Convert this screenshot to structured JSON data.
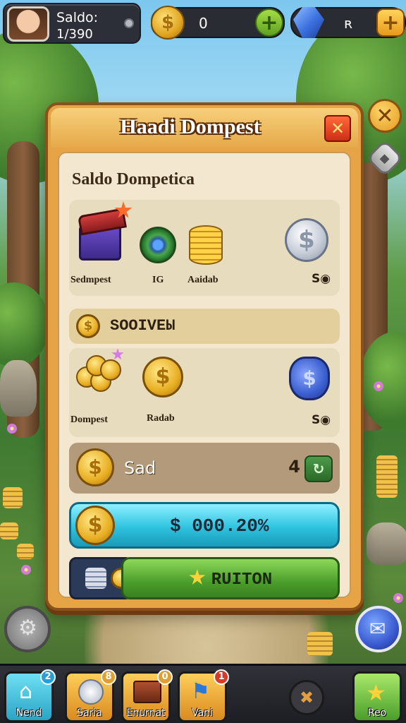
{
  "hud": {
    "profile_label": "Saldo:",
    "profile_value": "1/390",
    "coins_value": "0",
    "gems_value": "ʀ",
    "coin_glyph": "$",
    "plus_glyph": "+"
  },
  "panel": {
    "title": "Haadi Dompest",
    "close_glyph": "✕",
    "subtitle": "Saldo Dompetica",
    "row1": {
      "items": [
        {
          "label": "Sedmpest",
          "icon": "treasure-chest-icon"
        },
        {
          "label": "IG",
          "icon": "barrel-icon"
        },
        {
          "label": "Aaidab",
          "icon": "coin-stack-icon"
        }
      ],
      "price": "S◉",
      "silver_glyph": "$"
    },
    "section_label": "SOOIVEЫ",
    "row2": {
      "items": [
        {
          "label": "Dompest",
          "icon": "coin-pile-icon"
        },
        {
          "label": "Radab",
          "icon": "gold-coin-icon"
        }
      ],
      "price": "S◉",
      "pouch_glyph": "$"
    },
    "saldo_text": "Sad",
    "saldo_plus": "4",
    "saldo_btn_glyph": "↻",
    "amount_text": "$ 000.20%",
    "action_label": "RUITON"
  },
  "nav": {
    "items": [
      {
        "label": "Nend",
        "badge": "2",
        "color": "#3ec4e0"
      },
      {
        "label": "Saria",
        "badge": "8",
        "color": "#e6a040"
      },
      {
        "label": "Enurnat",
        "badge": "0",
        "color": "#e6a040"
      },
      {
        "label": "Vani",
        "badge": "1",
        "color": "#e6a040"
      },
      {
        "label": "Reo",
        "badge": "",
        "color": "#7ed048"
      }
    ]
  },
  "colors": {
    "accent": "#e7a446",
    "panel_bg": "#f3e8cf",
    "action_green": "#4a9e2a",
    "amount_cyan": "#2ec3e0"
  }
}
